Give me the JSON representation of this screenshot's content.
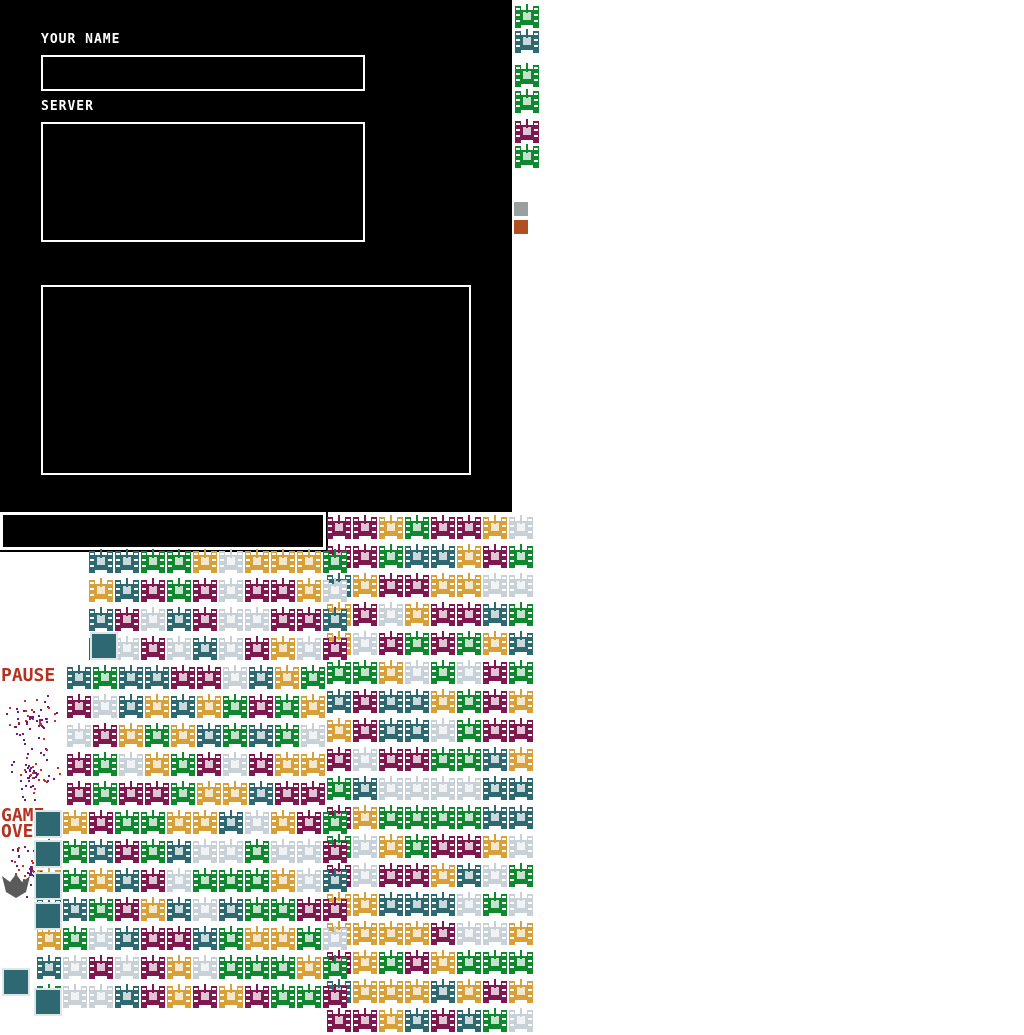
{
  "login": {
    "name_label": "YOUR NAME",
    "name_value": "",
    "server_label": "SERVER",
    "server_value": "",
    "log_value": ""
  },
  "chat": {
    "value": ""
  },
  "sheet": {
    "pause_text": "PAUSE",
    "game_text": "GAME",
    "over_text": "OVER"
  },
  "colors": {
    "tank_gold": "#d8a038",
    "tank_green": "#108830",
    "tank_purple": "#801850",
    "tank_steel": "#2e6870",
    "tank_light": "#c8d0d8",
    "label_red": "#b53120"
  }
}
